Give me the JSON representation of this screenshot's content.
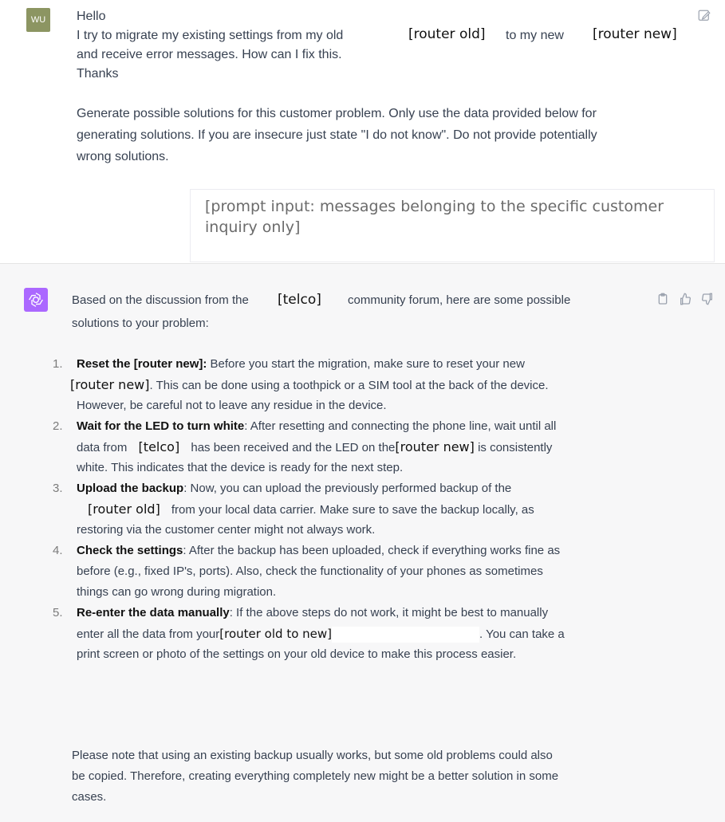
{
  "user": {
    "avatar_initials": "WU",
    "lines": [
      "Hello",
      "I try to migrate my existing settings from my old",
      "[router old]",
      "to my new",
      "[router new]",
      "and receive error messages. How can I fix this.",
      "Thanks",
      "Generate possible solutions for this customer problem. Only use the data provided below for",
      "generating solutions. If you are insecure just state \"I do not know\". Do not provide potentially",
      "wrong solutions."
    ],
    "prompt_input": "[prompt input: messages belonging to the specific customer inquiry only]"
  },
  "assistant": {
    "intro_a": "Based on the discussion from the",
    "intro_telco": "[telco]",
    "intro_b": "community forum, here are some possible",
    "intro_c": "solutions to your problem:",
    "items": [
      {
        "num": "1.",
        "title_a": "Reset the ",
        "title_token": "[router new]",
        "title_b": ":",
        "l1": "Before you start the migration, make sure to reset your new",
        "l2_token": "[router new]",
        "l2": ". This can be done using a toothpick or a SIM tool at the back of the device.",
        "l3": "However, be careful not to leave any residue in the device."
      },
      {
        "num": "2.",
        "title": "Wait for the LED to turn white",
        "l1": ": After resetting and connecting the phone line, wait until all",
        "l2a": "data from",
        "l2_token": "[telco]",
        "l2b": "has been received and the LED on the",
        "l2_token2": "[router new]",
        "l2c": "is consistently",
        "l3": "white. This indicates that the device is ready for the next step."
      },
      {
        "num": "3.",
        "title": "Upload the backup",
        "l1": ": Now, you can upload the previously performed backup of the",
        "l2_token": "[router old]",
        "l2": "from your local data carrier. Make sure to save the backup locally, as",
        "l3": "restoring via the customer center might not always work."
      },
      {
        "num": "4.",
        "title": "Check the settings",
        "l1": ": After the backup has been uploaded, check if everything works fine as",
        "l2": "before (e.g., fixed IP's, ports). Also, check the functionality of your phones as sometimes",
        "l3": "things can go wrong during migration."
      },
      {
        "num": "5.",
        "title": "Re-enter the data manually",
        "l1": ": If the above steps do not work, it might be best to manually",
        "l2a": "enter all the data from your",
        "l2_token": "[router old to new]",
        "l2b": ". You can take a",
        "l3": "print screen or photo of the settings on your old device to make this process easier."
      }
    ],
    "closing": [
      "Please note that using an existing backup usually works, but some old problems could also",
      "be copied. Therefore, creating everything completely new might be a better solution in some",
      "cases."
    ]
  },
  "colors": {
    "user_avatar": "#8c9562",
    "gpt_avatar": "#ab68ff",
    "assistant_bg": "#f7f7f8"
  },
  "icons": [
    "edit-icon",
    "openai-logo-icon",
    "copy-icon",
    "thumbs-up-icon",
    "thumbs-down-icon"
  ]
}
